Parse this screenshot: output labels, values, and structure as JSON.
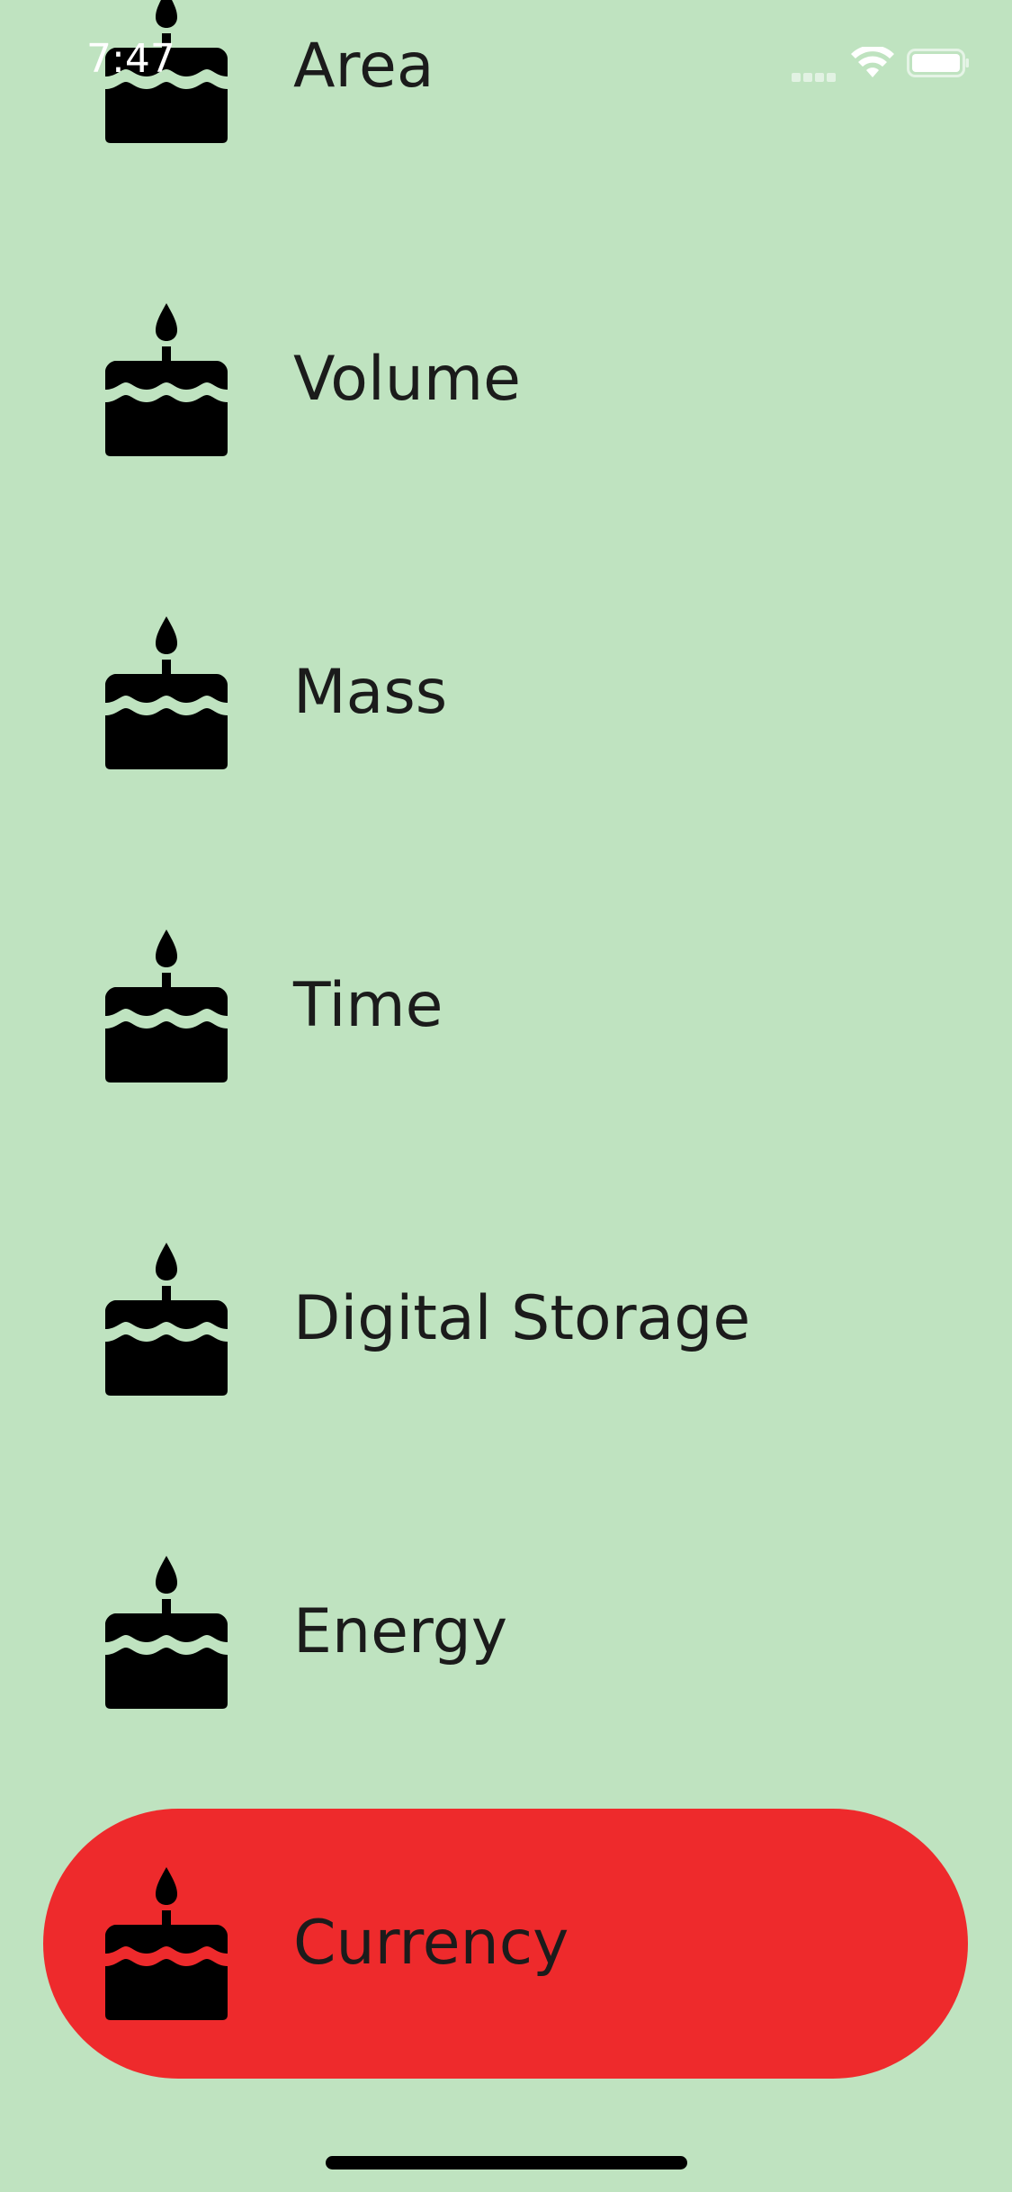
{
  "status_bar": {
    "time": "7:47",
    "wifi_icon": "wifi-icon",
    "battery_icon": "battery-icon",
    "signal_icon": "cellular-signal-icon"
  },
  "categories": [
    {
      "label": "Area",
      "icon": "cake-icon",
      "selected": false
    },
    {
      "label": "Volume",
      "icon": "cake-icon",
      "selected": false
    },
    {
      "label": "Mass",
      "icon": "cake-icon",
      "selected": false
    },
    {
      "label": "Time",
      "icon": "cake-icon",
      "selected": false
    },
    {
      "label": "Digital Storage",
      "icon": "cake-icon",
      "selected": false
    },
    {
      "label": "Energy",
      "icon": "cake-icon",
      "selected": false
    },
    {
      "label": "Currency",
      "icon": "cake-icon",
      "selected": true
    }
  ],
  "colors": {
    "background": "#bfe3c0",
    "selected_background": "#ee2a2c",
    "text": "#1b1b1b",
    "icon": "#000000"
  }
}
